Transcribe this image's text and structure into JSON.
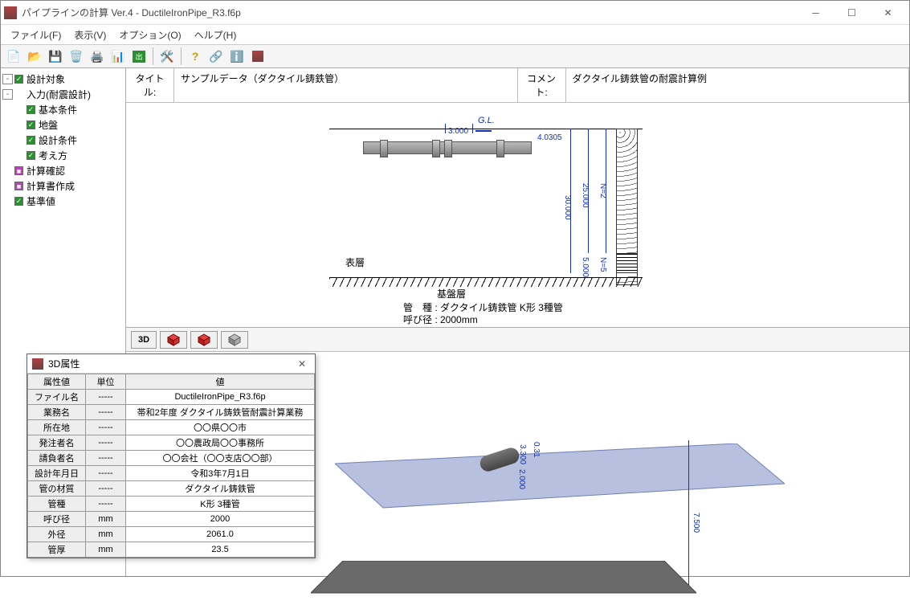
{
  "window": {
    "title": "パイプラインの計算 Ver.4 - DuctileIronPipe_R3.f6p"
  },
  "menu": {
    "file": "ファイル(F)",
    "view": "表示(V)",
    "option": "オプション(O)",
    "help": "ヘルプ(H)"
  },
  "tree": {
    "design_target": "設計対象",
    "input": "入力(耐震設計)",
    "basic": "基本条件",
    "ground": "地盤",
    "design_cond": "設計条件",
    "approach": "考え方",
    "calc_check": "計算確認",
    "report": "計算書作成",
    "standard": "基準値"
  },
  "info": {
    "title_lbl": "タイトル:",
    "title_val": "サンプルデータ（ダクタイル鋳鉄管）",
    "comment_lbl": "コメント:",
    "comment_val": "ダクタイル鋳鉄管の耐震計算例"
  },
  "diagram": {
    "gl": "G.L.",
    "dim_top": "3.000",
    "dim_h": "4.0305",
    "dim_30": "30.000",
    "dim_25": "25.000",
    "dim_n2": "N=2",
    "dim_5": "5.000",
    "dim_n5": "N=5",
    "surface": "表層",
    "base": "基盤層",
    "kind_line": "管　種 : ダクタイル鋳鉄管 K形 3種管",
    "dia_line": "呼び径 : 2000mm"
  },
  "view3d": {
    "btn": "3D",
    "dim_3300": "3.300",
    "dim_031": "0.31",
    "dim_2000": "2.000",
    "dim_7500": "7.500"
  },
  "props": {
    "title": "3D属性",
    "hdr": {
      "name": "属性値",
      "unit": "単位",
      "value": "値"
    },
    "rows": [
      {
        "n": "ファイル名",
        "u": "-----",
        "v": "DuctileIronPipe_R3.f6p"
      },
      {
        "n": "業務名",
        "u": "-----",
        "v": "帯和2年度 ダクタイル鋳鉄管耐震計算業務"
      },
      {
        "n": "所在地",
        "u": "-----",
        "v": "〇〇県〇〇市"
      },
      {
        "n": "発注者名",
        "u": "-----",
        "v": "〇〇農政局〇〇事務所"
      },
      {
        "n": "請負者名",
        "u": "-----",
        "v": "〇〇会社（〇〇支店〇〇部）"
      },
      {
        "n": "設計年月日",
        "u": "-----",
        "v": "令和3年7月1日"
      },
      {
        "n": "管の材質",
        "u": "-----",
        "v": "ダクタイル鋳鉄管"
      },
      {
        "n": "管種",
        "u": "-----",
        "v": "K形 3種管"
      },
      {
        "n": "呼び径",
        "u": "mm",
        "v": "2000"
      },
      {
        "n": "外径",
        "u": "mm",
        "v": "2061.0"
      },
      {
        "n": "管厚",
        "u": "mm",
        "v": "23.5"
      }
    ]
  }
}
